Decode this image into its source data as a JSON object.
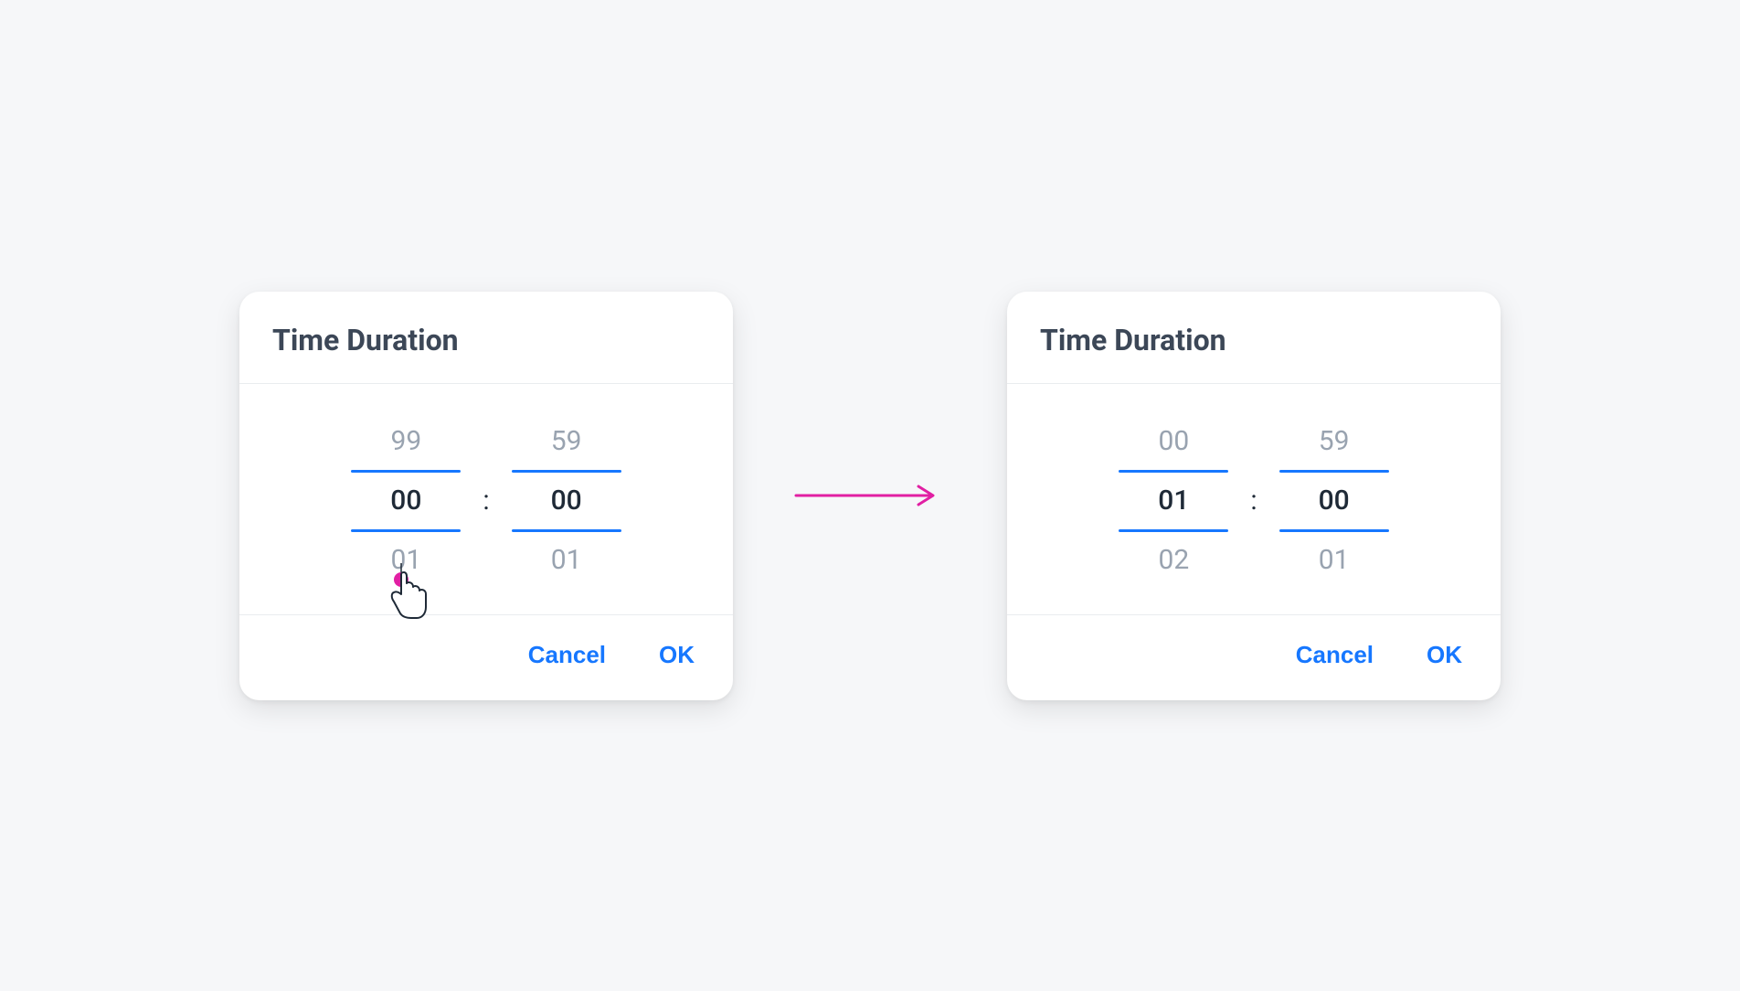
{
  "colors": {
    "accent": "#1677ff",
    "pointer": "#e11fa3",
    "text": "#1f2a37",
    "muted": "#99a3b0"
  },
  "cards": [
    {
      "title": "Time Duration",
      "hours": {
        "prev": "99",
        "current": "00",
        "next": "01"
      },
      "minutes": {
        "prev": "59",
        "current": "00",
        "next": "01"
      },
      "separator": ":",
      "buttons": {
        "cancel": "Cancel",
        "ok": "OK"
      },
      "show_pointer": true
    },
    {
      "title": "Time Duration",
      "hours": {
        "prev": "00",
        "current": "01",
        "next": "02"
      },
      "minutes": {
        "prev": "59",
        "current": "00",
        "next": "01"
      },
      "separator": ":",
      "buttons": {
        "cancel": "Cancel",
        "ok": "OK"
      },
      "show_pointer": false
    }
  ]
}
